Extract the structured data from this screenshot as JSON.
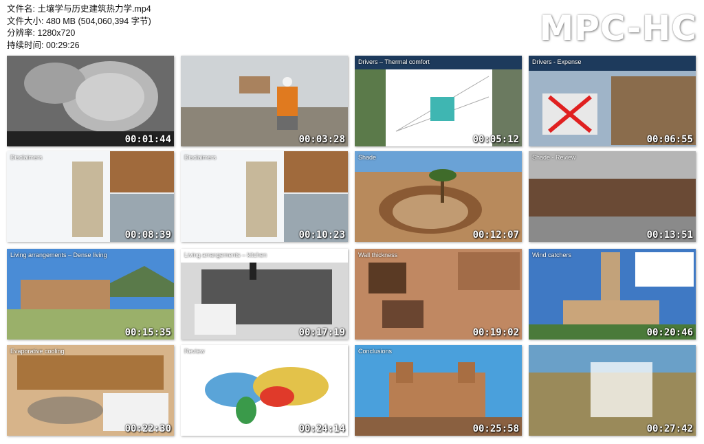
{
  "app": "MPC-HC",
  "info": {
    "filename": "文件名: 土壤学与历史建筑热力学.mp4",
    "filesize": "文件大小: 480 MB (504,060,394 字节)",
    "resolution": "分辨率: 1280x720",
    "duration": "持续时间: 00:29:26"
  },
  "thumbnails": [
    {
      "timestamp": "00:01:44",
      "title": "",
      "subtitle_cn": "",
      "subtitle_en": "",
      "scene": "microscope"
    },
    {
      "timestamp": "00:03:28",
      "title": "",
      "subtitle_cn": "",
      "subtitle_en": "",
      "scene": "worker"
    },
    {
      "timestamp": "00:05:12",
      "title": "Drivers – Thermal comfort",
      "subtitle_cn": "",
      "subtitle_en": "",
      "scene": "chart"
    },
    {
      "timestamp": "00:06:55",
      "title": "Drivers - Expense",
      "subtitle_cn": "",
      "subtitle_en": "",
      "scene": "expense"
    },
    {
      "timestamp": "00:08:39",
      "title": "Disclaimers",
      "subtitle_cn": "",
      "subtitle_en": "",
      "scene": "disclaimers"
    },
    {
      "timestamp": "00:10:23",
      "title": "Disclaimers",
      "subtitle_cn": "",
      "subtitle_en": "",
      "scene": "disclaimers"
    },
    {
      "timestamp": "00:12:07",
      "title": "Shade",
      "subtitle_cn": "",
      "subtitle_en": "",
      "scene": "shade"
    },
    {
      "timestamp": "00:13:51",
      "title": "Shade - Review",
      "subtitle_cn": "",
      "subtitle_en": "",
      "scene": "tulou"
    },
    {
      "timestamp": "00:15:35",
      "title": "Living arrangements – Dense living",
      "subtitle_cn": "",
      "subtitle_en": "",
      "scene": "pueblo"
    },
    {
      "timestamp": "00:17:19",
      "title": "Living arrangements – kitchen",
      "subtitle_cn": "",
      "subtitle_en": "",
      "scene": "kitchen"
    },
    {
      "timestamp": "00:19:02",
      "title": "Wall thickness",
      "subtitle_cn": "",
      "subtitle_en": "",
      "scene": "walls"
    },
    {
      "timestamp": "00:20:46",
      "title": "Wind catchers",
      "subtitle_cn": "",
      "subtitle_en": "",
      "scene": "windcatcher"
    },
    {
      "timestamp": "00:22:30",
      "title": "Evaporative cooling",
      "subtitle_cn": "",
      "subtitle_en": "",
      "scene": "alhambra"
    },
    {
      "timestamp": "00:24:14",
      "title": "Review",
      "subtitle_cn": "",
      "subtitle_en": "",
      "scene": "map"
    },
    {
      "timestamp": "00:25:58",
      "title": "Conclusions",
      "subtitle_cn": "",
      "subtitle_en": "",
      "scene": "kasbah"
    },
    {
      "timestamp": "00:27:42",
      "title": "",
      "subtitle_cn": "",
      "subtitle_en": "",
      "scene": "thanks"
    }
  ]
}
